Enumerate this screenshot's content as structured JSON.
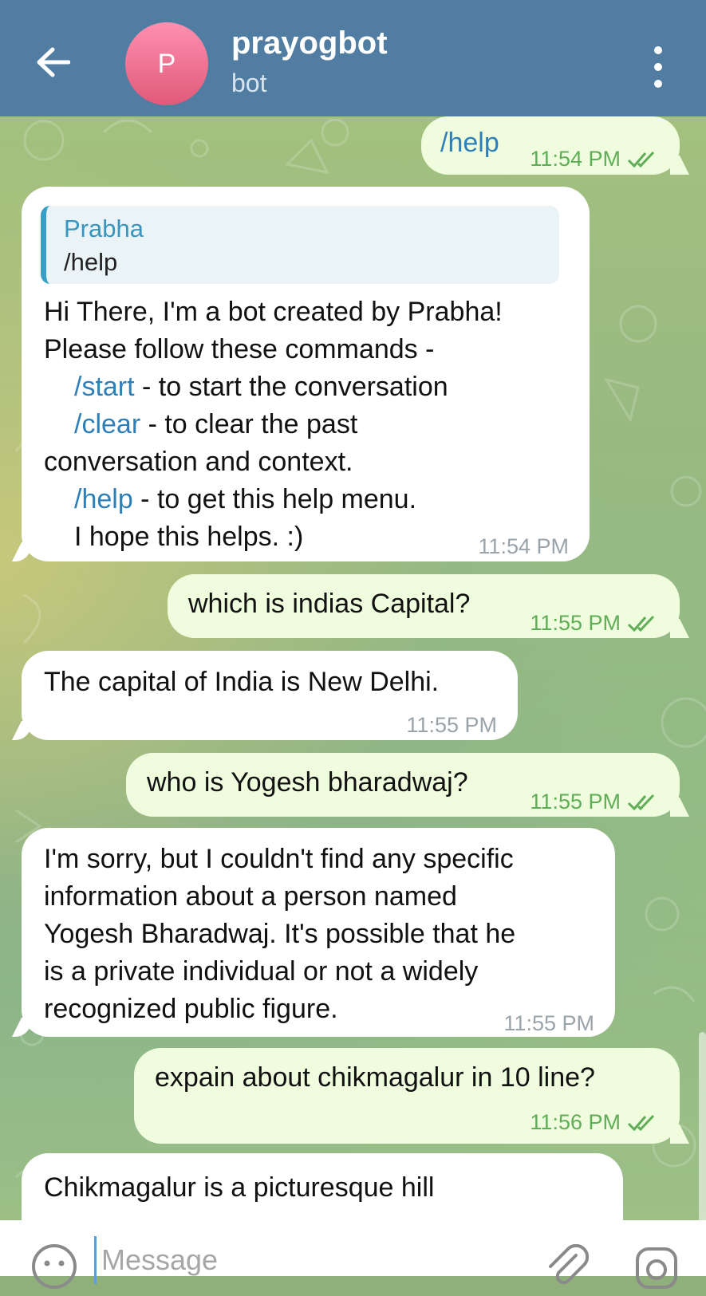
{
  "header": {
    "title": "prayogbot",
    "subtitle": "bot",
    "avatar_letter": "P"
  },
  "messages": [
    {
      "direction": "out",
      "text": "/help",
      "time": "11:54 PM"
    },
    {
      "direction": "in",
      "reply_to": {
        "name": "Prabha",
        "text": "/help"
      },
      "lines": [
        {
          "text": "Hi There, I'm a bot created by Prabha!"
        },
        {
          "text": "Please follow these commands -"
        },
        {
          "cmd": "/start",
          "rest": " - to start the conversation"
        },
        {
          "cmd": "/clear",
          "rest": " - to clear the past"
        },
        {
          "text": "conversation and context."
        },
        {
          "cmd": "/help",
          "rest": " - to get this help menu."
        },
        {
          "text": "I hope this helps. :)"
        }
      ],
      "time": "11:54 PM"
    },
    {
      "direction": "out",
      "text": "which is indias Capital?",
      "time": "11:55 PM"
    },
    {
      "direction": "in",
      "text": "The capital of India is New Delhi.",
      "time": "11:55 PM"
    },
    {
      "direction": "out",
      "text": "who is Yogesh bharadwaj?",
      "time": "11:55 PM"
    },
    {
      "direction": "in",
      "lines": [
        "I'm sorry, but I couldn't find any specific",
        "information about a person named",
        "Yogesh Bharadwaj. It's possible that he",
        "is a private individual or not a widely",
        "recognized public figure."
      ],
      "time": "11:55 PM"
    },
    {
      "direction": "out",
      "text": "expain about chikmagalur in 10 line?",
      "time": "11:56 PM"
    },
    {
      "direction": "in",
      "text": "Chikmagalur is a picturesque hill",
      "time": ""
    }
  ],
  "input": {
    "placeholder": "Message"
  },
  "icons": {
    "back": "arrow-left-icon",
    "menu": "more-vertical-icon",
    "emoji": "emoji-icon",
    "attach": "paperclip-icon",
    "camera": "camera-icon",
    "read": "double-check-icon"
  },
  "colors": {
    "header": "#517da2",
    "outgoing": "#effdde",
    "incoming": "#ffffff",
    "link": "#2e7fb8",
    "time_out": "#5fae57"
  }
}
